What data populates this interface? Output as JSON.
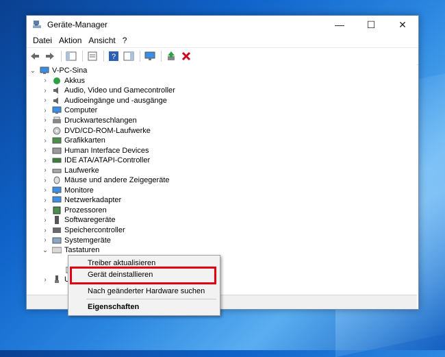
{
  "window": {
    "title": "Geräte-Manager",
    "buttons": {
      "minimize": "—",
      "maximize": "☐",
      "close": "✕"
    }
  },
  "menu": [
    "Datei",
    "Aktion",
    "Ansicht",
    "?"
  ],
  "tree": {
    "root": "V-PC-Sina",
    "items": [
      {
        "label": "Akkus",
        "icon": "battery-icon"
      },
      {
        "label": "Audio, Video und Gamecontroller",
        "icon": "speaker-icon"
      },
      {
        "label": "Audioeingänge und -ausgänge",
        "icon": "speaker-icon"
      },
      {
        "label": "Computer",
        "icon": "monitor-icon"
      },
      {
        "label": "Druckwarteschlangen",
        "icon": "printer-icon"
      },
      {
        "label": "DVD/CD-ROM-Laufwerke",
        "icon": "disc-icon"
      },
      {
        "label": "Grafikkarten",
        "icon": "display-adapter-icon"
      },
      {
        "label": "Human Interface Devices",
        "icon": "hid-icon"
      },
      {
        "label": "IDE ATA/ATAPI-Controller",
        "icon": "controller-icon"
      },
      {
        "label": "Laufwerke",
        "icon": "drive-icon"
      },
      {
        "label": "Mäuse und andere Zeigegeräte",
        "icon": "mouse-icon"
      },
      {
        "label": "Monitore",
        "icon": "monitor-icon"
      },
      {
        "label": "Netzwerkadapter",
        "icon": "network-icon"
      },
      {
        "label": "Prozessoren",
        "icon": "processor-icon"
      },
      {
        "label": "Softwaregeräte",
        "icon": "software-device-icon"
      },
      {
        "label": "Speichercontroller",
        "icon": "storage-icon"
      },
      {
        "label": "Systemgeräte",
        "icon": "system-icon"
      },
      {
        "label": "Tastaturen",
        "icon": "keyboard-icon"
      }
    ],
    "child_partial": "",
    "after_partial": "US"
  },
  "context_menu": {
    "items": [
      "Treiber aktualisieren",
      "Gerät deinstallieren",
      "Nach geänderter Hardware suchen",
      "Eigenschaften"
    ]
  },
  "colors": {
    "highlight_box": "#e3000f",
    "accent": "#0078d7"
  }
}
